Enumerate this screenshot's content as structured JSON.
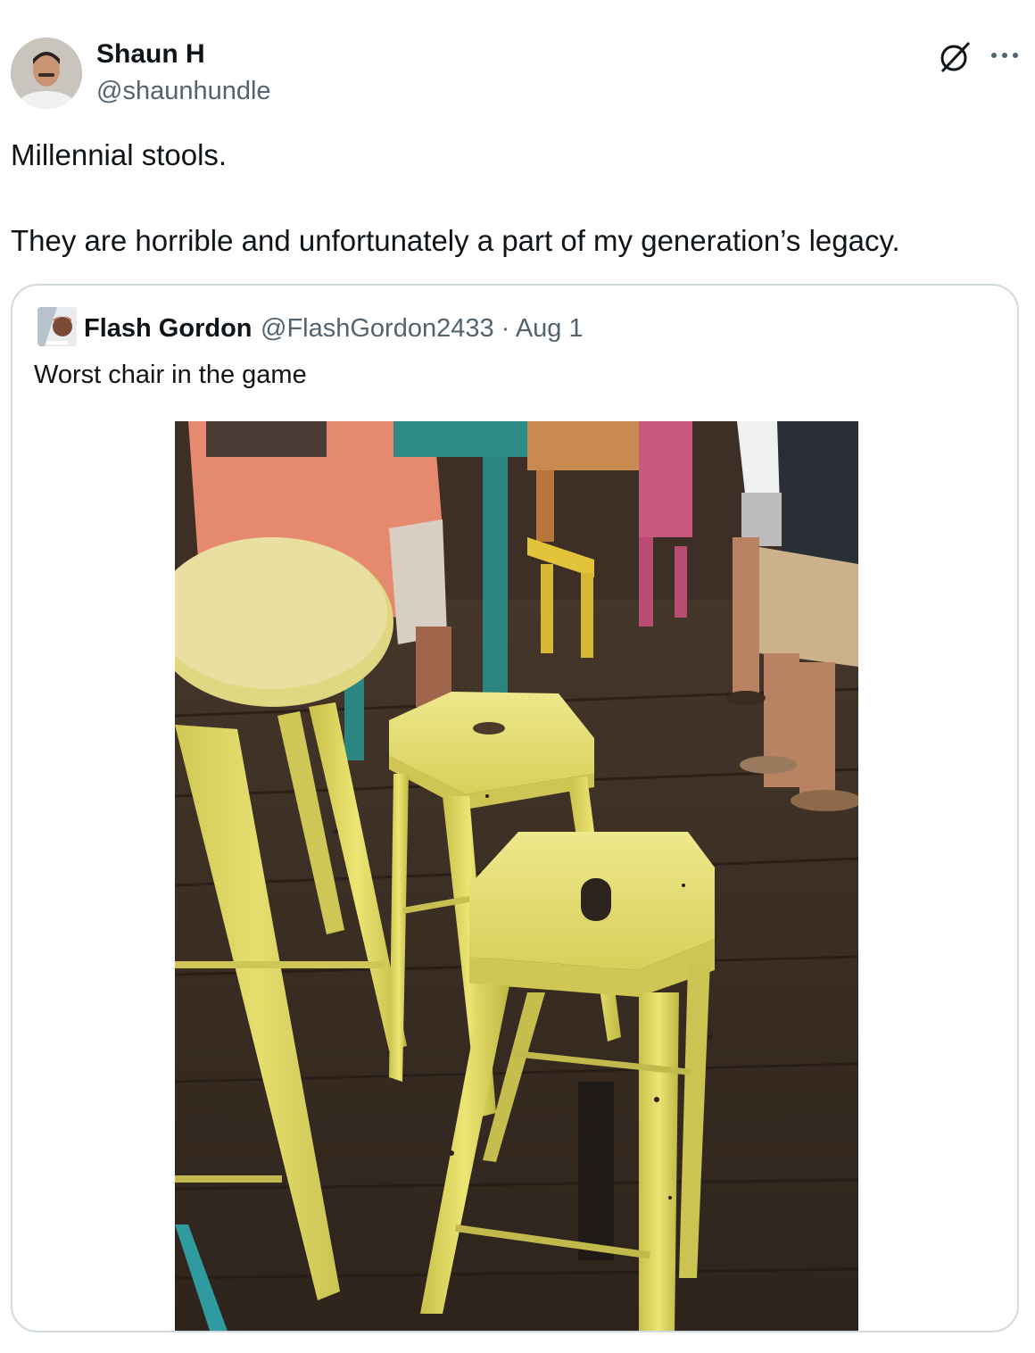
{
  "author": {
    "name": "Shaun H",
    "handle": "@shaunhundle"
  },
  "tweet": {
    "line1": "Millennial stools.",
    "line2": "They are horrible and unfortunately a part of my generation’s legacy."
  },
  "quote": {
    "name": "Flash Gordon",
    "handle": "@FlashGordon2433",
    "separator": "·",
    "date": "Aug 1",
    "text": "Worst chair in the game",
    "photo_icon": "photo-of-yellow-metal-bar-stools"
  },
  "icons": {
    "grok": "grok-icon",
    "more": "more-icon"
  },
  "colors": {
    "text": "#0f1419",
    "secondary": "#536471",
    "border": "#cfd9de",
    "stool_yellow": "#e3dc6a",
    "floor": "#3a2f26"
  }
}
